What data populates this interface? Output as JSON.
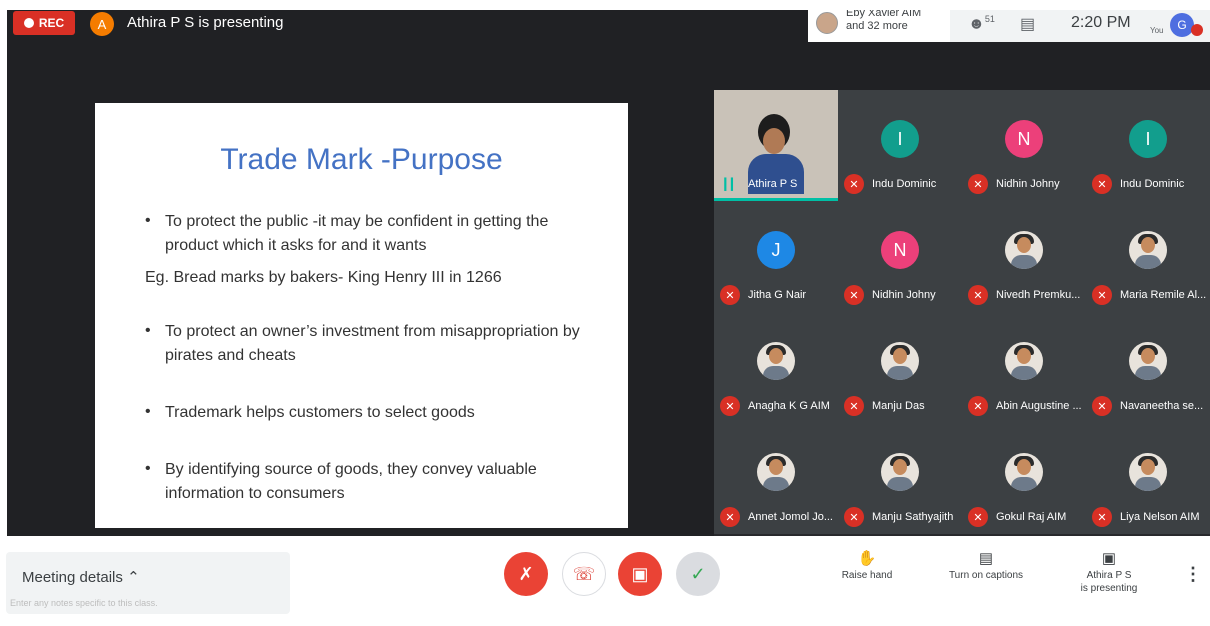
{
  "topbar": {
    "rec_label": "REC",
    "presenter_initial": "A",
    "presenting_text": "Athira P S is presenting",
    "participants_line1": "Eby Xavier AIM",
    "participants_line2": "and 32 more",
    "people_count": "51",
    "time": "2:20 PM",
    "you_label": "You",
    "account_initial": "G",
    "colors": {
      "rec": "#d93025",
      "presenter_avatar": "#f57c00",
      "account": "#4e6ee0"
    }
  },
  "slide": {
    "title": "Trade Mark -Purpose",
    "bullet_1": "To protect the public -it may be confident in getting the product which it asks for and it wants",
    "example": "Eg. Bread marks by bakers- King Henry III in 1266",
    "bullet_2": "To protect an owner’s investment from misappropriation by pirates and cheats",
    "bullet_3": "Trademark helps customers to select goods",
    "bullet_4": "By identifying source of goods, they convey valuable information to consumers",
    "title_color": "#4472c4"
  },
  "participants": [
    {
      "name": "Athira P S",
      "type": "self"
    },
    {
      "name": "Indu Dominic",
      "initial": "I",
      "color": "#129e8d"
    },
    {
      "name": "Nidhin Johny",
      "initial": "N",
      "color": "#ec407a"
    },
    {
      "name": "Indu Dominic",
      "initial": "I",
      "color": "#129e8d"
    },
    {
      "name": "Jitha G Nair",
      "initial": "J",
      "color": "#1e88e5"
    },
    {
      "name": "Nidhin Johny",
      "initial": "N",
      "color": "#ec407a"
    },
    {
      "name": "Nivedh Premku...",
      "type": "photo"
    },
    {
      "name": "Maria Remile Al...",
      "type": "photo"
    },
    {
      "name": "Anagha K G AIM",
      "type": "photo"
    },
    {
      "name": "Manju Das",
      "type": "photo"
    },
    {
      "name": "Abin Augustine ...",
      "type": "photo"
    },
    {
      "name": "Navaneetha se...",
      "type": "photo"
    },
    {
      "name": "Annet Jomol Jo...",
      "type": "photo"
    },
    {
      "name": "Manju Sathyajith",
      "type": "photo"
    },
    {
      "name": "Gokul Raj AIM",
      "type": "photo"
    },
    {
      "name": "Liya Nelson AIM",
      "type": "photo"
    }
  ],
  "bottombar": {
    "meeting_details": "Meeting details",
    "notes_hint": "Enter any notes specific to this class.",
    "raise_hand": "Raise hand",
    "captions": "Turn on captions",
    "presenting_line1": "Athira P S",
    "presenting_line2": "is presenting"
  }
}
